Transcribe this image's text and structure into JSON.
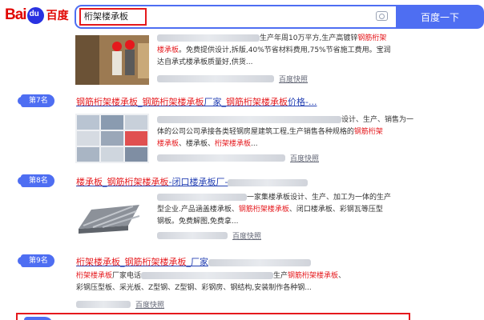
{
  "header": {
    "logo_bai": "Bai",
    "logo_cn": "百度",
    "query": "桁架楼承板",
    "search_button": "百度一下"
  },
  "result0": {
    "abstract_line1": "生产年周10万平方,生产高镀锌",
    "abstract_hl1": "钢筋桁架",
    "abstract_line2_pre": "楼承板",
    "abstract_line2": "。免费提供设计,拆版,40%节省材料费用,75%节省施工费用。宝润",
    "abstract_line3": "达自承式楼承板质量好,供货...",
    "kuaizhao": "百度快照"
  },
  "result7": {
    "rank": "第7名",
    "title_parts": [
      "钢筋桁架楼承板",
      "_",
      "钢筋桁架楼承板",
      "厂家_",
      "钢筋桁架楼承板",
      "价格-..."
    ],
    "abstract_l1_tail": "设计、生产、销售为一",
    "abstract_l2": "体的公司公司承接各类轻钢房屋建筑工程,生产销售各种规格的",
    "abstract_l2_hl": "钢筋桁架",
    "abstract_l3_hl1": "楼承板",
    "abstract_l3_mid": "、楼承板、",
    "abstract_l3_hl2": "桁架楼承板",
    "abstract_l3_tail": "...",
    "kuaizhao": "百度快照"
  },
  "result8": {
    "rank": "第8名",
    "title_parts": [
      "楼承板",
      "_",
      "钢筋桁架楼承板",
      "-闭口楼承板厂-"
    ],
    "abstract_l1_tail": "一家集楼承板设计、生产、加工为一体的生产",
    "abstract_l2_pre": "型企业.产品涵盖楼承板、",
    "abstract_l2_hl": "钢筋桁架楼承板",
    "abstract_l2_tail": "、闭口楼承板、彩钢瓦等压型",
    "abstract_l3": "钢板。免费解图,免费拿...",
    "kuaizhao": "百度快照"
  },
  "result9": {
    "rank": "第9名",
    "title_parts": [
      "桁架楼承板",
      "_",
      "钢筋桁架楼承板",
      "_厂家"
    ],
    "abstract_l1_hl1": "桁架楼承板",
    "abstract_l1_mid": "厂家电话",
    "abstract_l1_tail": "生产",
    "abstract_l1_hl2": "钢筋桁架楼承板",
    "abstract_l1_end": "、",
    "abstract_l2": "彩钢压型板、采光板、Z型钢、Z型钢、彩钢房、钢结构,安装制作各种钢...",
    "kuaizhao": "百度快照"
  }
}
